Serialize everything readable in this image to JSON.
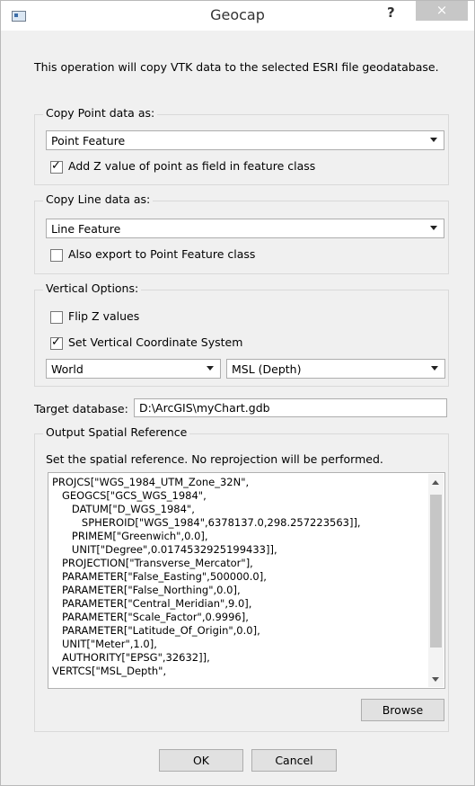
{
  "window": {
    "title": "Geocap",
    "help_label": "?",
    "close_label": "×"
  },
  "intro_text": "This operation will copy VTK data to the selected ESRI file geodatabase.",
  "point_group": {
    "title": "Copy Point data as:",
    "selected": "Point Feature",
    "checkbox_label": "Add Z value of point as field in feature class",
    "checked": true
  },
  "line_group": {
    "title": "Copy Line data as:",
    "selected": "Line Feature",
    "checkbox_label": "Also export to Point Feature class",
    "checked": false
  },
  "vertical_group": {
    "title": "Vertical Options:",
    "flip_label": "Flip Z values",
    "flip_checked": false,
    "vcs_label": "Set Vertical Coordinate System",
    "vcs_checked": true,
    "world_selected": "World",
    "depth_selected": "MSL (Depth)"
  },
  "target": {
    "label": "Target database:",
    "value": "D:\\ArcGIS\\myChart.gdb"
  },
  "output_group": {
    "title": "Output Spatial Reference",
    "note": "Set the spatial reference. No reprojection will be performed.",
    "spatial_reference_text": "PROJCS[\"WGS_1984_UTM_Zone_32N\",\n   GEOGCS[\"GCS_WGS_1984\",\n      DATUM[\"D_WGS_1984\",\n         SPHEROID[\"WGS_1984\",6378137.0,298.257223563]],\n      PRIMEM[\"Greenwich\",0.0],\n      UNIT[\"Degree\",0.0174532925199433]],\n   PROJECTION[\"Transverse_Mercator\"],\n   PARAMETER[\"False_Easting\",500000.0],\n   PARAMETER[\"False_Northing\",0.0],\n   PARAMETER[\"Central_Meridian\",9.0],\n   PARAMETER[\"Scale_Factor\",0.9996],\n   PARAMETER[\"Latitude_Of_Origin\",0.0],\n   UNIT[\"Meter\",1.0],\n   AUTHORITY[\"EPSG\",32632]],\nVERTCS[\"MSL_Depth\",",
    "browse_label": "Browse"
  },
  "buttons": {
    "ok": "OK",
    "cancel": "Cancel"
  }
}
